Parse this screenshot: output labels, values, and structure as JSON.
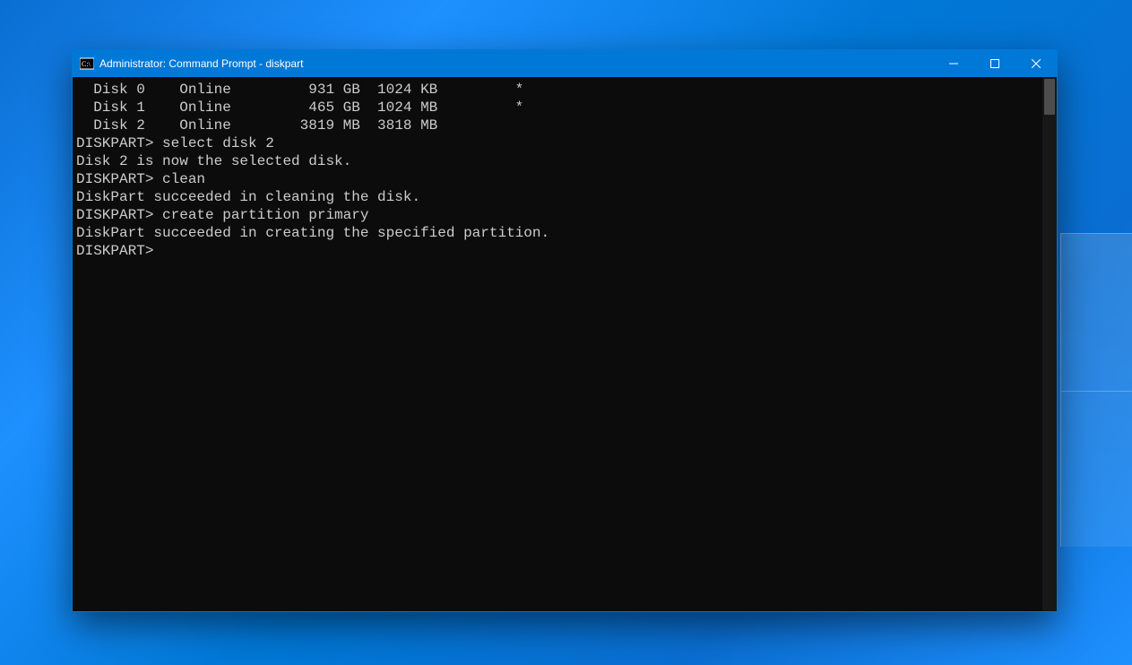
{
  "window": {
    "title": "Administrator: Command Prompt - diskpart"
  },
  "terminal": {
    "diskList": [
      {
        "name": "Disk 0",
        "status": "Online",
        "size": "931 GB",
        "free": "1024 KB",
        "dyn": "",
        "gpt": "*"
      },
      {
        "name": "Disk 1",
        "status": "Online",
        "size": "465 GB",
        "free": "1024 MB",
        "dyn": "",
        "gpt": "*"
      },
      {
        "name": "Disk 2",
        "status": "Online",
        "size": "3819 MB",
        "free": "3818 MB",
        "dyn": "",
        "gpt": ""
      }
    ],
    "lines": {
      "blank": "",
      "prompt1": "DISKPART> select disk 2",
      "resp1": "Disk 2 is now the selected disk.",
      "prompt2": "DISKPART> clean",
      "resp2": "DiskPart succeeded in cleaning the disk.",
      "prompt3": "DISKPART> create partition primary",
      "resp3": "DiskPart succeeded in creating the specified partition.",
      "prompt4": "DISKPART> "
    }
  }
}
